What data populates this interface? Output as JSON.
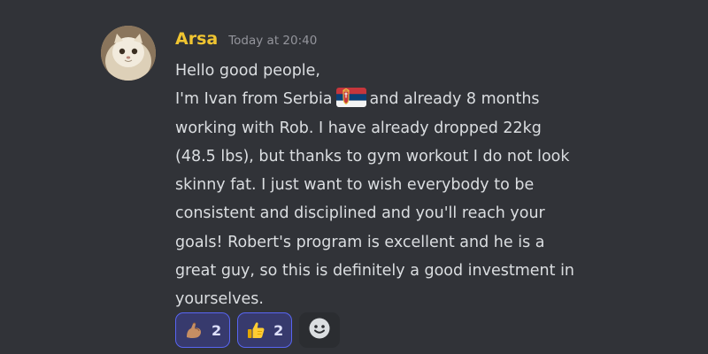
{
  "message": {
    "author": "Arsa",
    "timestamp": "Today at 20:40",
    "lines": [
      "Hello good people,",
      "I'm Ivan from Serbia",
      "and already 8 months",
      "working with Rob. I have already dropped 22kg",
      "(48.5 lbs), but thanks to gym workout I do not look",
      "skinny fat. I just want to wish everybody to be",
      "consistent and disciplined and you'll reach your",
      "goals! Robert's program is excellent and he is a",
      "great guy, so this is definitely a good investment in",
      "yourselves."
    ],
    "inline_emoji": "serbia-flag-icon"
  },
  "reactions": [
    {
      "emoji": "flexed-biceps-icon",
      "count": "2"
    },
    {
      "emoji": "thumbs-up-icon",
      "count": "2"
    }
  ],
  "add_reaction_icon": "smiley-icon",
  "colors": {
    "background": "#313338",
    "username": "#f0c531",
    "text": "#dbdee1",
    "timestamp": "#94959c",
    "reaction_bg": "#373a6d",
    "reaction_border": "#5865f2"
  }
}
